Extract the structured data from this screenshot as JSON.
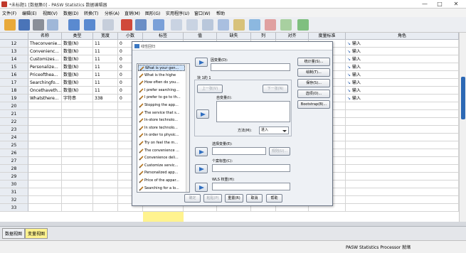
{
  "window": {
    "title": "*未标题1 [数据集0] - PASW Statistics 数据编辑器",
    "minimize": "—",
    "maximize": "□",
    "close": "✕"
  },
  "menu": [
    "文件(F)",
    "编辑(E)",
    "视图(V)",
    "数据(D)",
    "转换(T)",
    "分析(A)",
    "直销(M)",
    "图形(G)",
    "实用程序(U)",
    "窗口(W)",
    "帮助"
  ],
  "grid": {
    "columns": [
      "名称",
      "类型",
      "宽度",
      "小数",
      "标签",
      "值",
      "缺失",
      "列",
      "对齐",
      "度量标准",
      "角色"
    ],
    "rows": [
      {
        "n": "12",
        "name": "Theconvenie...",
        "type": "数值(N)",
        "width": "11",
        "dec": "0",
        "role": "输入"
      },
      {
        "n": "13",
        "name": "Convenienc...",
        "type": "数值(N)",
        "width": "11",
        "dec": "0",
        "role": "输入"
      },
      {
        "n": "14",
        "name": "Customizes...",
        "type": "数值(N)",
        "width": "11",
        "dec": "0",
        "role": "输入"
      },
      {
        "n": "15",
        "name": "Personalize...",
        "type": "数值(N)",
        "width": "11",
        "dec": "0",
        "role": "输入"
      },
      {
        "n": "16",
        "name": "Priceofthea...",
        "type": "数值(N)",
        "width": "11",
        "dec": "0",
        "role": "输入"
      },
      {
        "n": "17",
        "name": "Searchingfo...",
        "type": "数值(N)",
        "width": "11",
        "dec": "0",
        "role": "输入"
      },
      {
        "n": "18",
        "name": "Oncethaveth...",
        "type": "数值(N)",
        "width": "11",
        "dec": "0",
        "role": "输入"
      },
      {
        "n": "19",
        "name": "Whatsthere...",
        "type": "字符串",
        "width": "338",
        "dec": "0",
        "role": "输入"
      },
      {
        "n": "20"
      },
      {
        "n": "21"
      },
      {
        "n": "22"
      },
      {
        "n": "23"
      },
      {
        "n": "24"
      },
      {
        "n": "25"
      },
      {
        "n": "26"
      },
      {
        "n": "27"
      },
      {
        "n": "28"
      },
      {
        "n": "29"
      },
      {
        "n": "30"
      },
      {
        "n": "31"
      },
      {
        "n": "32"
      },
      {
        "n": "33"
      }
    ]
  },
  "tabs": {
    "data_view": "数据视图",
    "variable_view": "变量视图"
  },
  "status": "PASW Statistics Processor 就绪",
  "dialog": {
    "title": "线性回归",
    "variables": [
      "What is your gen...",
      "What is the highe",
      "How often do you...",
      "I prefer searching...",
      "I prefer to go to th...",
      "Stopping the app...",
      "The service that s...",
      "In-store technolo...",
      "In store technolo...",
      "In order to physic...",
      "Try on feel the m...",
      "The convenience ...",
      "Convenience deli...",
      "Customize servic...",
      "Personalized app...",
      "Price of the appar...",
      "Searching for a lo..."
    ],
    "dependent_label": "因变量(D):",
    "block_label": "块 1的 1",
    "prev_btn": "上一张(V)",
    "next_btn": "下一张(N)",
    "independent_label": "自变量(I):",
    "method_label": "方法(M):",
    "method_value": "进入",
    "selection_label": "选择变量(E):",
    "rule_btn": "规则(U)...",
    "case_label": "个案标签(C):",
    "wls_label": "WLS 权重(H):",
    "side_buttons": [
      "统计量(S)...",
      "绘制(T)...",
      "保存(S)...",
      "选项(O)...",
      "Bootstrap(B)..."
    ],
    "bottom_buttons": [
      "确定",
      "粘贴(P)",
      "重置(R)",
      "取消",
      "帮助"
    ]
  }
}
